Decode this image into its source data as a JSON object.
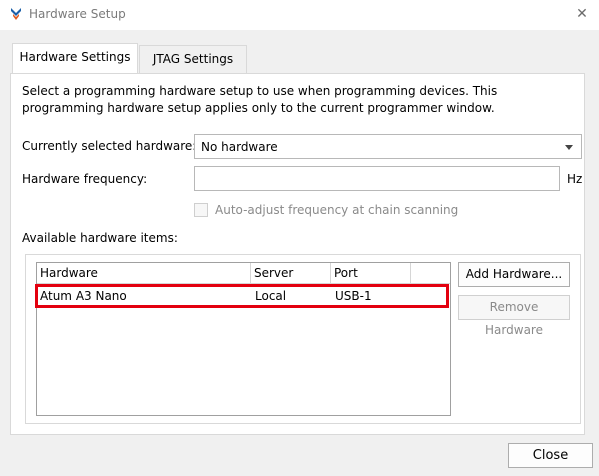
{
  "window": {
    "title": "Hardware Setup"
  },
  "tabs": [
    {
      "label": "Hardware Settings",
      "active": true
    },
    {
      "label": "JTAG Settings",
      "active": false
    }
  ],
  "description": "Select a programming hardware setup to use when programming devices. This programming hardware setup applies only to the current programmer window.",
  "form": {
    "current_hw_label": "Currently selected hardware:",
    "current_hw_value": "No hardware",
    "freq_label": "Hardware frequency:",
    "freq_value": "",
    "freq_unit": "Hz",
    "auto_adjust_label": "Auto-adjust frequency at chain scanning",
    "auto_adjust_checked": false
  },
  "available": {
    "label": "Available hardware items:",
    "columns": [
      "Hardware",
      "Server",
      "Port"
    ],
    "rows": [
      {
        "hardware": "Atum A3 Nano",
        "server": "Local",
        "port": "USB-1"
      }
    ]
  },
  "buttons": {
    "add": "Add Hardware...",
    "remove": "Remove Hardware",
    "close": "Close"
  },
  "colors": {
    "highlight": "#e3000f"
  }
}
